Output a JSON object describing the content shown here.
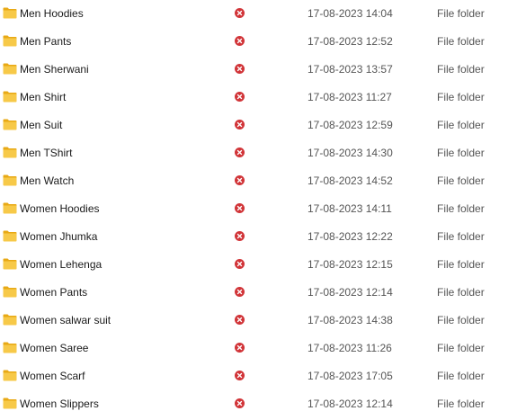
{
  "colors": {
    "folder_body": "#f7c948",
    "folder_tab": "#e8a915",
    "status_error": "#d13438",
    "meta_text": "#555555"
  },
  "icons": {
    "folder": "folder-icon",
    "status": "sync-error-icon"
  },
  "files": [
    {
      "name": "Men Hoodies",
      "status": "sync error",
      "date_modified": "17-08-2023 14:04",
      "type": "File folder"
    },
    {
      "name": "Men Pants",
      "status": "sync error",
      "date_modified": "17-08-2023 12:52",
      "type": "File folder"
    },
    {
      "name": "Men Sherwani",
      "status": "sync error",
      "date_modified": "17-08-2023 13:57",
      "type": "File folder"
    },
    {
      "name": "Men Shirt",
      "status": "sync error",
      "date_modified": "17-08-2023 11:27",
      "type": "File folder"
    },
    {
      "name": "Men Suit",
      "status": "sync error",
      "date_modified": "17-08-2023 12:59",
      "type": "File folder"
    },
    {
      "name": "Men TShirt",
      "status": "sync error",
      "date_modified": "17-08-2023 14:30",
      "type": "File folder"
    },
    {
      "name": "Men Watch",
      "status": "sync error",
      "date_modified": "17-08-2023 14:52",
      "type": "File folder"
    },
    {
      "name": "Women Hoodies",
      "status": "sync error",
      "date_modified": "17-08-2023 14:11",
      "type": "File folder"
    },
    {
      "name": "Women Jhumka",
      "status": "sync error",
      "date_modified": "17-08-2023 12:22",
      "type": "File folder"
    },
    {
      "name": "Women Lehenga",
      "status": "sync error",
      "date_modified": "17-08-2023 12:15",
      "type": "File folder"
    },
    {
      "name": "Women Pants",
      "status": "sync error",
      "date_modified": "17-08-2023 12:14",
      "type": "File folder"
    },
    {
      "name": "Women salwar suit",
      "status": "sync error",
      "date_modified": "17-08-2023 14:38",
      "type": "File folder"
    },
    {
      "name": "Women Saree",
      "status": "sync error",
      "date_modified": "17-08-2023 11:26",
      "type": "File folder"
    },
    {
      "name": "Women Scarf",
      "status": "sync error",
      "date_modified": "17-08-2023 17:05",
      "type": "File folder"
    },
    {
      "name": "Women Slippers",
      "status": "sync error",
      "date_modified": "17-08-2023 12:14",
      "type": "File folder"
    }
  ]
}
